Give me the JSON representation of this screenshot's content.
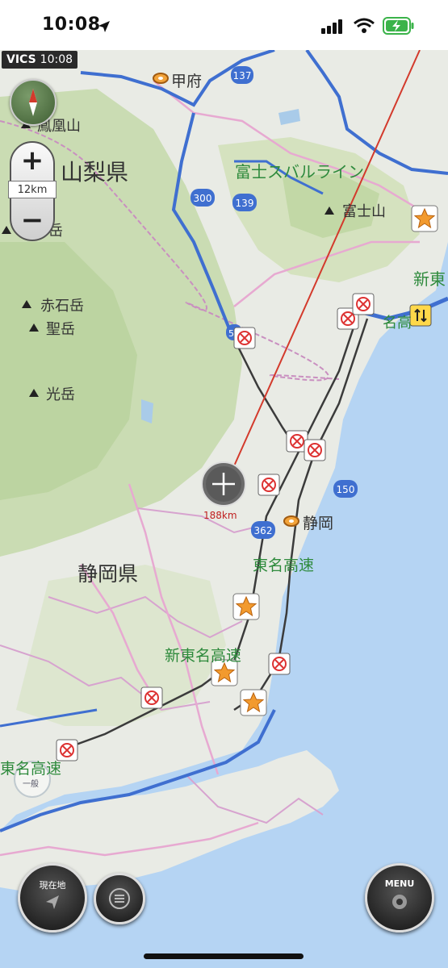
{
  "status": {
    "time": "10:08"
  },
  "vics": {
    "label": "VICS",
    "time": "10:08"
  },
  "zoom": {
    "plus": "+",
    "minus": "−",
    "scale": "12km"
  },
  "cursor": {
    "distance": "188km"
  },
  "labels": {
    "kofu": "甲府",
    "houou": "鳳凰山",
    "yamanashi": "山梨県",
    "subaru": "富士スバルライン",
    "fuji": "富士山",
    "akaishi": "赤石岳",
    "hijiri": "聖岳",
    "hikari": "光岳",
    "shizuoka_city": "静岡",
    "shizuoka_pref": "静岡県",
    "tomei": "東名高速",
    "shintomei": "新東名高速",
    "tomei_w": "東名高速",
    "shin_e": "新東",
    "meiko": "名高",
    "gaku": "岳"
  },
  "routes": {
    "r137": "137",
    "r300": "300",
    "r139": "139",
    "r150": "150",
    "r362": "362",
    "r52": "52"
  },
  "buttons": {
    "current_location": "現在地",
    "menu": "MENU",
    "ippan": "一般"
  },
  "colors": {
    "sea": "#b5d4f3",
    "land": "#e8eae4",
    "mountain": "#c9dbb2",
    "expressway": "#3f6fd0",
    "pref_border": "#c98fc0",
    "route_line": "#d33a2c"
  }
}
